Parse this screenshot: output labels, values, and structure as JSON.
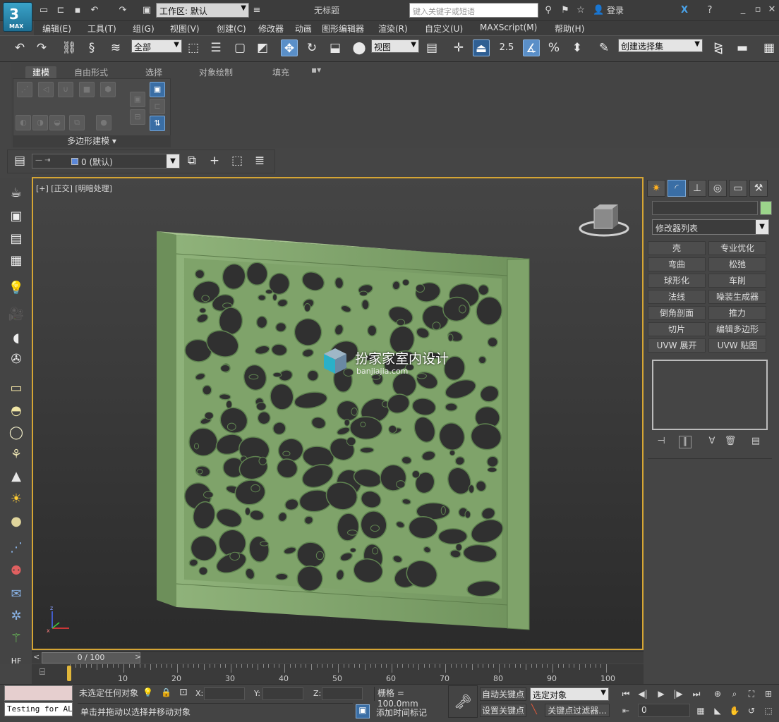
{
  "app": {
    "logo_text": "MAX",
    "workspace_label": "工作区: 默认",
    "title": "无标题",
    "search_placeholder": "键入关键字或短语",
    "login_label": "登录"
  },
  "menu": [
    "编辑(E)",
    "工具(T)",
    "组(G)",
    "视图(V)",
    "创建(C)",
    "修改器",
    "动画",
    "图形编辑器",
    "渲染(R)",
    "自定义(U)",
    "MAXScript(M)",
    "帮助(H)"
  ],
  "toolbar": {
    "filter_value": "全部",
    "refcoord_value": "视图",
    "snap_value": "2.5",
    "named_selection_value": "创建选择集"
  },
  "ribbon": {
    "tabs": [
      "建模",
      "自由形式",
      "选择",
      "对象绘制",
      "填充"
    ],
    "panel_caption": "多边形建模"
  },
  "layer": {
    "current": "0 (默认)"
  },
  "viewport": {
    "label": "[+] [正交] [明暗处理]",
    "object_color": "#7fa36a",
    "watermark_title": "扮家家室内设计",
    "watermark_url": "banjiajia.com"
  },
  "command_panel": {
    "modifier_list_label": "修改器列表",
    "object_color": "#9cd58b",
    "modifiers": [
      [
        "壳",
        "专业优化"
      ],
      [
        "弯曲",
        "松弛"
      ],
      [
        "球形化",
        "车削"
      ],
      [
        "法线",
        "噪装生成器"
      ],
      [
        "倒角剖面",
        "推力"
      ],
      [
        "切片",
        "编辑多边形"
      ],
      [
        "UVW 展开",
        "UVW 贴图"
      ]
    ]
  },
  "timeline": {
    "slider_label": "0 / 100",
    "ticks": [
      "10",
      "20",
      "30",
      "40",
      "50",
      "60",
      "70",
      "80",
      "90",
      "100"
    ]
  },
  "status": {
    "maxscript_output": "Testing for ALC",
    "selection_info": "未选定任何对象",
    "prompt": "单击并拖动以选择并移动对象",
    "x_label": "X:",
    "y_label": "Y:",
    "z_label": "Z:",
    "grid": "栅格 = 100.0mm",
    "add_time_tag": "添加时间标记",
    "auto_key": "自动关键点",
    "set_key": "设置关键点",
    "key_mode_value": "选定对象",
    "key_filters": "关键点过滤器...",
    "current_frame": "0"
  }
}
